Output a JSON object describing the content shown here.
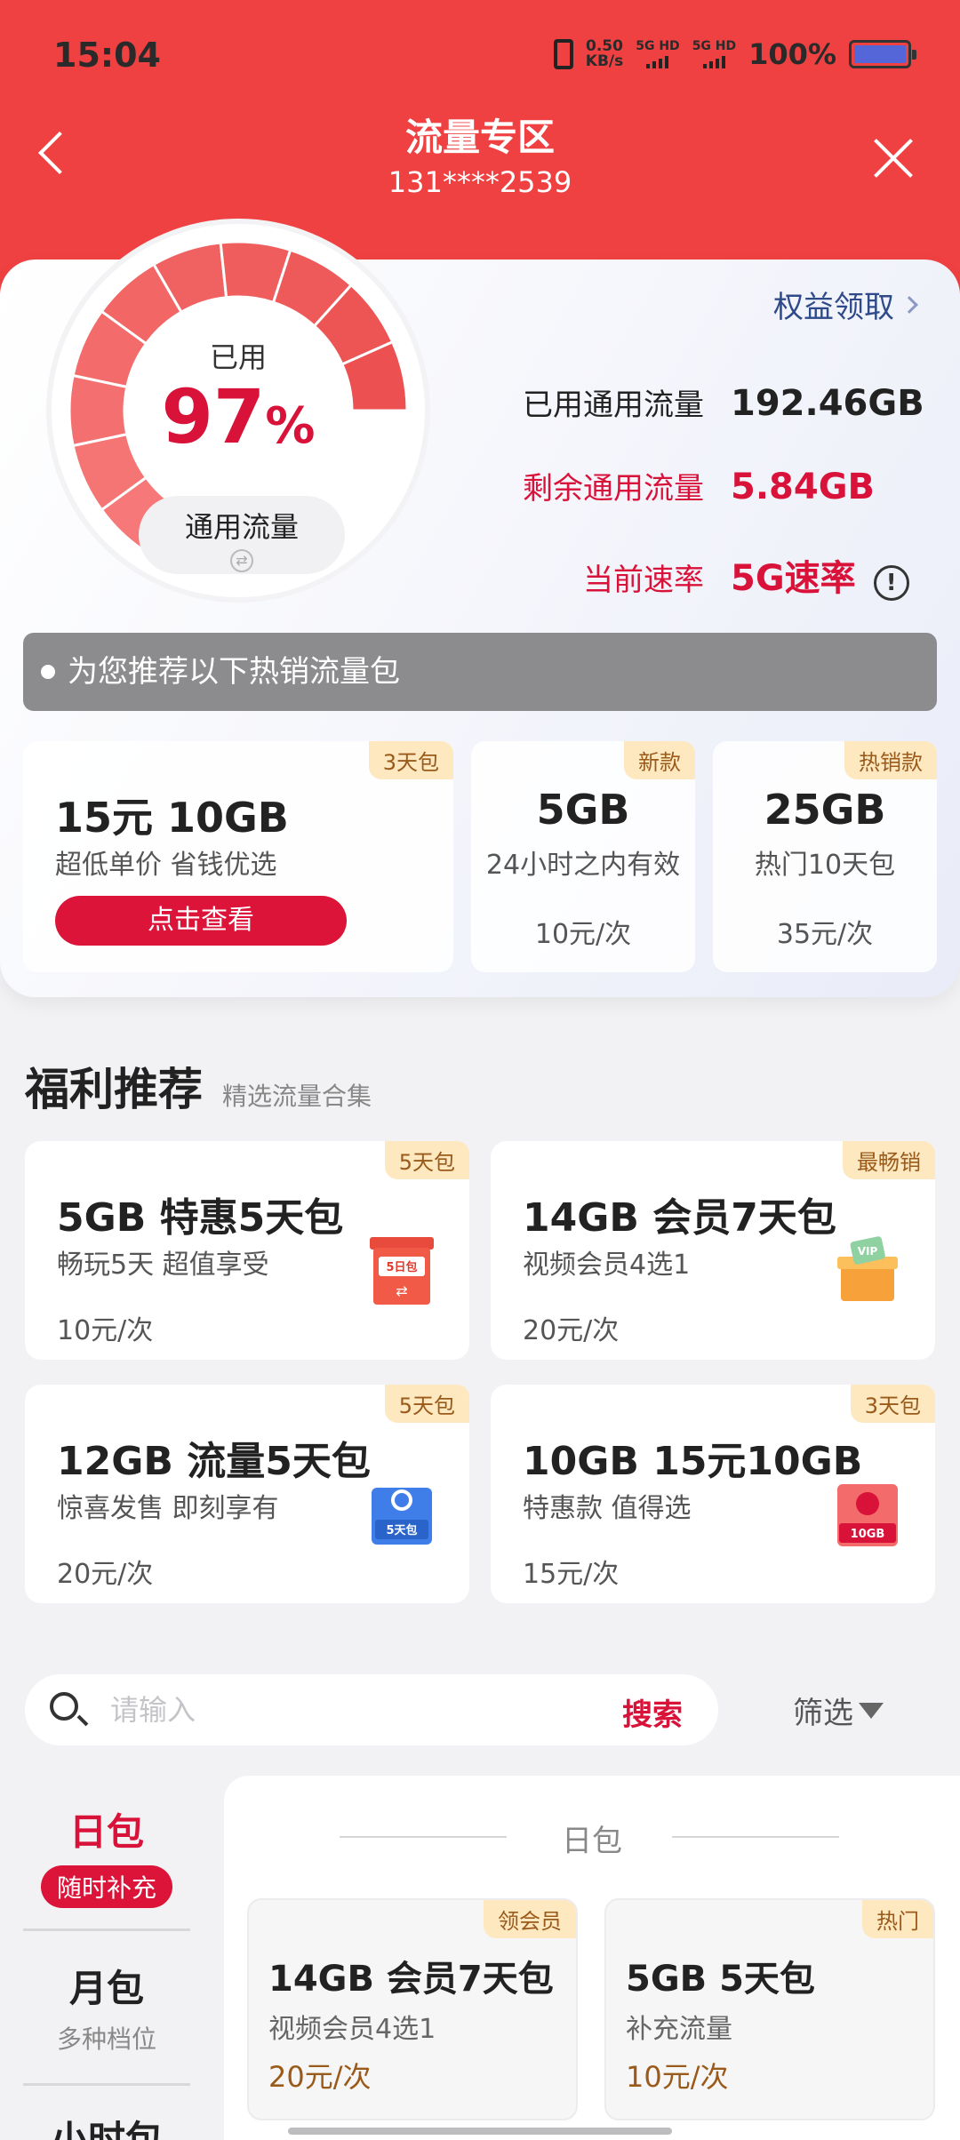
{
  "status_bar": {
    "time": "15:04",
    "net_speed": "0.50",
    "net_unit": "KB/s",
    "sim1": "5G HD",
    "sim2": "5G HD",
    "battery_pct": "100%"
  },
  "header": {
    "title": "流量专区",
    "phone": "131****2539"
  },
  "usage": {
    "gauge_label": "已用",
    "percent": "97",
    "percent_sign": "%",
    "percent_value": 97,
    "type_label": "通用流量",
    "rights_link": "权益领取",
    "used_label": "已用通用流量",
    "used_value": "192.46GB",
    "remain_label": "剩余通用流量",
    "remain_value": "5.84GB",
    "rate_label": "当前速率",
    "rate_value": "5G速率"
  },
  "recommend": {
    "banner": "为您推荐以下热销流量包",
    "packages": [
      {
        "tag": "3天包",
        "title": "15元 10GB",
        "desc": "超低单价 省钱优选",
        "button": "点击查看"
      },
      {
        "tag": "新款",
        "title": "5GB",
        "desc": "24小时之内有效",
        "price": "10元/次"
      },
      {
        "tag": "热销款",
        "title": "25GB",
        "desc": "热门10天包",
        "price": "35元/次"
      }
    ]
  },
  "welfare": {
    "title": "福利推荐",
    "subtitle": "精选流量合集",
    "cards": [
      {
        "tag": "5天包",
        "title": "5GB  特惠5天包",
        "desc": "畅玩5天 超值享受",
        "price": "10元/次",
        "icon_text": "5日包"
      },
      {
        "tag": "最畅销",
        "title": "14GB  会员7天包",
        "desc": "视频会员4选1",
        "price": "20元/次",
        "icon_text": "VIP"
      },
      {
        "tag": "5天包",
        "title": "12GB  流量5天包",
        "desc": "惊喜发售 即刻享有",
        "price": "20元/次",
        "icon_text": "5天包"
      },
      {
        "tag": "3天包",
        "title": "10GB  15元10GB",
        "desc": "特惠款 值得选",
        "price": "15元/次",
        "icon_text": "10GB"
      }
    ]
  },
  "search": {
    "placeholder": "请输入",
    "button": "搜索",
    "filter": "筛选"
  },
  "categories": {
    "day": {
      "name": "日包",
      "badge": "随时补充"
    },
    "month": {
      "name": "月包",
      "desc": "多种档位"
    },
    "hour": {
      "name": "小时包"
    }
  },
  "list": {
    "heading": "日包",
    "items": [
      {
        "tag": "领会员",
        "title": "14GB 会员7天包",
        "desc": "视频会员4选1",
        "price": "20元/次"
      },
      {
        "tag": "热门",
        "title": "5GB 5天包",
        "desc": "补充流量",
        "price": "10元/次"
      }
    ]
  },
  "colors": {
    "brand_red": "#ef4141",
    "accent_red": "#d9123a",
    "tag_bg": "#fde8c0"
  }
}
